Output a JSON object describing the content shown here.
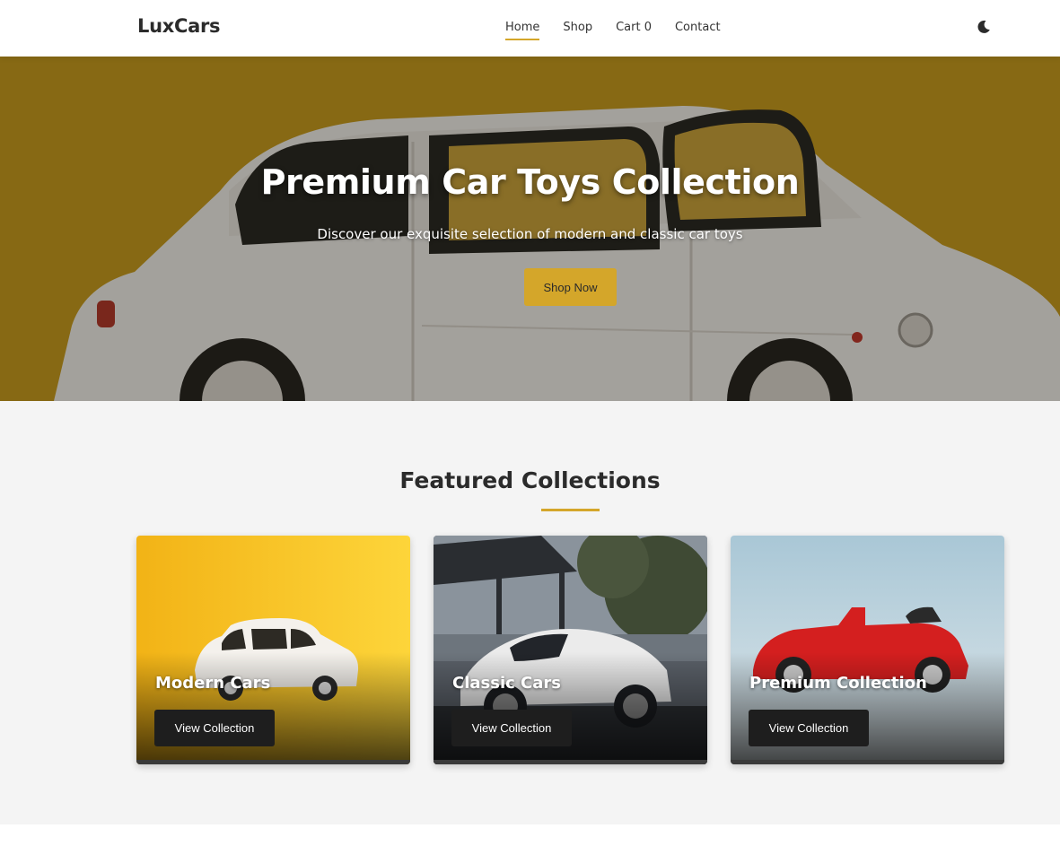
{
  "navbar": {
    "logo": "LuxCars",
    "links": [
      {
        "label": "Home",
        "active": true
      },
      {
        "label": "Shop",
        "active": false
      },
      {
        "label": "Cart 0",
        "active": false
      },
      {
        "label": "Contact",
        "active": false
      }
    ],
    "theme_icon": "moon-icon"
  },
  "hero": {
    "title": "Premium Car Toys Collection",
    "subtitle": "Discover our exquisite selection of modern and classic car toys",
    "cta_label": "Shop Now"
  },
  "featured": {
    "title": "Featured Collections",
    "cards": [
      {
        "title": "Modern Cars",
        "button_label": "View Collection"
      },
      {
        "title": "Classic Cars",
        "button_label": "View Collection"
      },
      {
        "title": "Premium Collection",
        "button_label": "View Collection"
      }
    ]
  },
  "colors": {
    "accent": "#d4a62a",
    "dark": "#1e1e1e",
    "section_bg": "#f4f4f4"
  }
}
